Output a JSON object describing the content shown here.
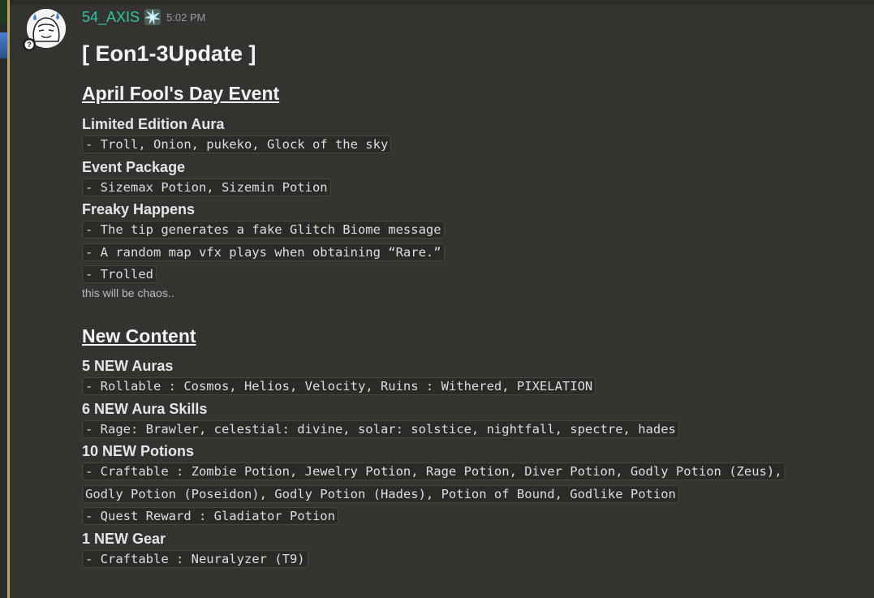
{
  "message": {
    "username": "54_AXIS",
    "timestamp": "5:02 PM",
    "title": "[ Eon1-3Update ]",
    "sections": {
      "april": {
        "heading": "April Fool's Day Event",
        "limited_heading": "Limited Edition Aura",
        "limited_line": "- Troll, Onion, pukeko, Glock of the sky",
        "package_heading": "Event Package",
        "package_line": "- Sizemax Potion, Sizemin Potion",
        "freaky_heading": "Freaky Happens",
        "freaky_lines": [
          "- The tip generates a fake Glitch Biome message",
          "- A random map vfx plays when obtaining “Rare.”",
          "- Trolled"
        ],
        "note": "this will be chaos.."
      },
      "new_content": {
        "heading": "New Content",
        "auras_heading": "5 NEW Auras",
        "auras_line": "- Rollable : Cosmos, Helios, Velocity, Ruins : Withered, PIXELATION",
        "skills_heading": "6 NEW Aura Skills",
        "skills_line": "- Rage: Brawler, celestial: divine, solar: solstice, nightfall, spectre, hades",
        "potions_heading": "10 NEW Potions",
        "potions_line_1": "- Craftable : Zombie Potion, Jewelry Potion, Rage Potion, Diver Potion, Godly Potion (Zeus),",
        "potions_line_2": "Godly Potion (Poseidon), Godly Potion (Hades), Potion of Bound, Godlike Potion",
        "potions_line_3": "- Quest Reward : Gladiator Potion",
        "gear_heading": "1 NEW Gear",
        "gear_line": "- Craftable : Neuralyzer (T9)"
      }
    }
  },
  "colors": {
    "background": "#35332f",
    "username": "#2dc7a4",
    "timestamp": "#949ba4",
    "accent_bar": "#c8a04a"
  },
  "icons": {
    "badge_icon": "question-badge-icon",
    "name_icon": "sparkle-icon"
  }
}
